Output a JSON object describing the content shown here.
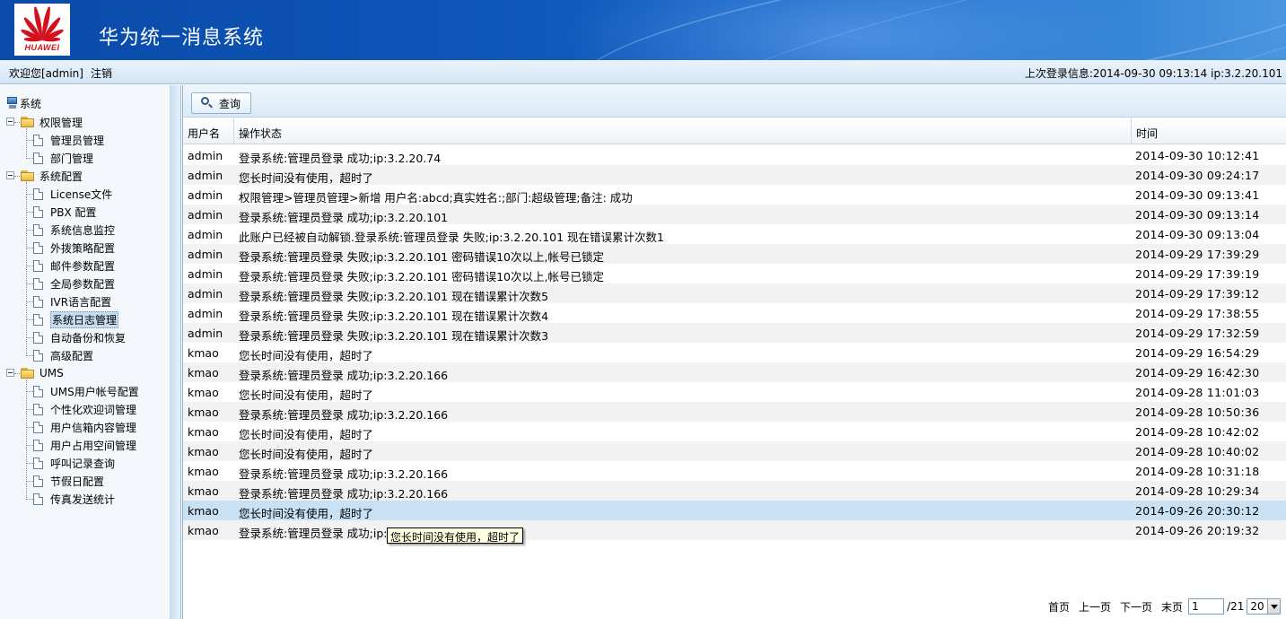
{
  "header": {
    "logo_text": "HUAWEI",
    "app_title": "华为统一消息系统"
  },
  "infobar": {
    "welcome": "欢迎您[admin]",
    "logout": "注销",
    "last_login": "上次登录信息:2014-09-30 09:13:14 ip:3.2.20.101"
  },
  "sidebar": {
    "root": "系统",
    "groups": [
      {
        "label": "权限管理",
        "items": [
          "管理员管理",
          "部门管理"
        ]
      },
      {
        "label": "系统配置",
        "items": [
          "License文件",
          " PBX 配置",
          "系统信息监控",
          "外拨策略配置",
          "邮件参数配置",
          "全局参数配置",
          "IVR语言配置",
          "系统日志管理",
          "自动备份和恢复",
          "高级配置"
        ]
      },
      {
        "label": "UMS",
        "items": [
          "UMS用户帐号配置",
          "个性化欢迎词管理",
          "用户信箱内容管理",
          "用户占用空间管理",
          "呼叫记录查询",
          "节假日配置",
          "传真发送统计"
        ]
      }
    ],
    "selected": "系统日志管理"
  },
  "toolbar": {
    "query_label": "查询"
  },
  "table": {
    "columns": [
      "用户名",
      "操作状态",
      "时间"
    ],
    "rows": [
      [
        "admin",
        "登录系统:管理员登录 成功;ip:3.2.20.74",
        "2014-09-30 10:12:41"
      ],
      [
        "admin",
        "您长时间没有使用，超时了",
        "2014-09-30 09:24:17"
      ],
      [
        "admin",
        "权限管理>管理员管理>新增 用户名:abcd;真实姓名:;部门:超级管理;备注: 成功",
        "2014-09-30 09:13:41"
      ],
      [
        "admin",
        "登录系统:管理员登录 成功;ip:3.2.20.101",
        "2014-09-30 09:13:14"
      ],
      [
        "admin",
        "此账户已经被自动解锁.登录系统:管理员登录 失败;ip:3.2.20.101 现在错误累计次数1",
        "2014-09-30 09:13:04"
      ],
      [
        "admin",
        "登录系统:管理员登录 失败;ip:3.2.20.101 密码错误10次以上,帐号已锁定",
        "2014-09-29 17:39:29"
      ],
      [
        "admin",
        "登录系统:管理员登录 失败;ip:3.2.20.101 密码错误10次以上,帐号已锁定",
        "2014-09-29 17:39:19"
      ],
      [
        "admin",
        "登录系统:管理员登录 失败;ip:3.2.20.101 现在错误累计次数5",
        "2014-09-29 17:39:12"
      ],
      [
        "admin",
        "登录系统:管理员登录 失败;ip:3.2.20.101 现在错误累计次数4",
        "2014-09-29 17:38:55"
      ],
      [
        "admin",
        "登录系统:管理员登录 失败;ip:3.2.20.101 现在错误累计次数3",
        "2014-09-29 17:32:59"
      ],
      [
        "kmao",
        "您长时间没有使用，超时了",
        "2014-09-29 16:54:29"
      ],
      [
        "kmao",
        "登录系统:管理员登录 成功;ip:3.2.20.166",
        "2014-09-29 16:42:30"
      ],
      [
        "kmao",
        "您长时间没有使用，超时了",
        "2014-09-28 11:01:03"
      ],
      [
        "kmao",
        "登录系统:管理员登录 成功;ip:3.2.20.166",
        "2014-09-28 10:50:36"
      ],
      [
        "kmao",
        "您长时间没有使用，超时了",
        "2014-09-28 10:42:02"
      ],
      [
        "kmao",
        "您长时间没有使用，超时了",
        "2014-09-28 10:40:02"
      ],
      [
        "kmao",
        "登录系统:管理员登录 成功;ip:3.2.20.166",
        "2014-09-28 10:31:18"
      ],
      [
        "kmao",
        "登录系统:管理员登录 成功;ip:3.2.20.166",
        "2014-09-28 10:29:34"
      ],
      [
        "kmao",
        "您长时间没有使用，超时了",
        "2014-09-26 20:30:12"
      ],
      [
        "kmao",
        "登录系统:管理员登录 成功;ip:3.2.20.166",
        "2014-09-26 20:19:32"
      ]
    ],
    "highlighted_row": 18
  },
  "tooltip": "您长时间没有使用，超时了",
  "pager": {
    "first": "首页",
    "prev": "上一页",
    "next": "下一页",
    "last": "末页",
    "current_page": "1",
    "total": "/21",
    "page_size": "20"
  },
  "colors": {
    "banner": "#0d55b8",
    "highlight_row": "#c9e1f5",
    "logo_red": "#d4101e"
  }
}
